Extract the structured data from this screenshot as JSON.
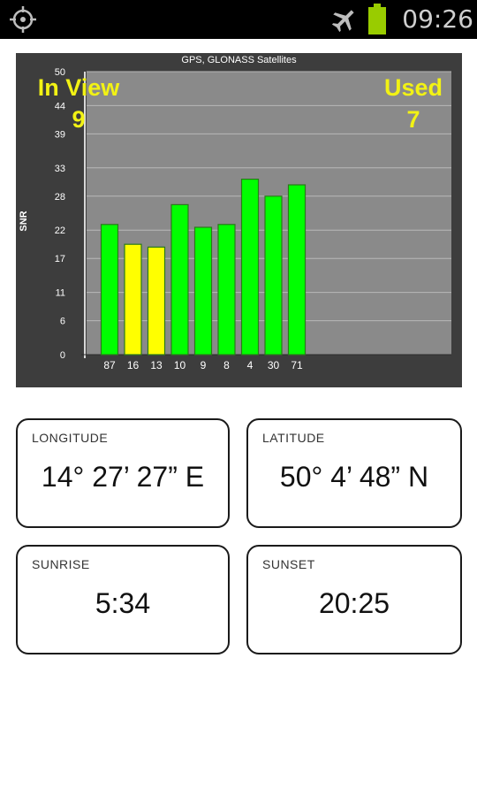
{
  "status_bar": {
    "time": "09:26",
    "icons": [
      "gps-icon",
      "airplane-mode-icon",
      "battery-icon"
    ],
    "battery_color": "#99cc00"
  },
  "chart": {
    "in_view_label": "In View",
    "in_view_count": "9",
    "used_label": "Used",
    "used_count": "7",
    "overlay_color": "#f2f214"
  },
  "chart_data": {
    "type": "bar",
    "title": "GPS, GLONASS Satellites",
    "xlabel": "",
    "ylabel": "SNR",
    "ylim": [
      0,
      50
    ],
    "y_ticks": [
      "0",
      "6",
      "11",
      "17",
      "22",
      "28",
      "33",
      "39",
      "44",
      "50"
    ],
    "categories": [
      "87",
      "16",
      "13",
      "10",
      "9",
      "8",
      "4",
      "30",
      "71"
    ],
    "values": [
      23,
      19.5,
      19,
      26.5,
      22.5,
      23,
      31,
      28,
      30
    ],
    "used": [
      true,
      false,
      false,
      true,
      true,
      true,
      true,
      true,
      true
    ],
    "colors": {
      "used": "#00ff00",
      "not_used": "#ffff00",
      "background": "#3d3d3d",
      "plot_area": "#8a8a8a"
    }
  },
  "cards": {
    "longitude": {
      "label": "LONGITUDE",
      "value": "14° 27’ 27” E"
    },
    "latitude": {
      "label": "LATITUDE",
      "value": "50° 4’ 48” N"
    },
    "sunrise": {
      "label": "SUNRISE",
      "value": "5:34"
    },
    "sunset": {
      "label": "SUNSET",
      "value": "20:25"
    }
  }
}
